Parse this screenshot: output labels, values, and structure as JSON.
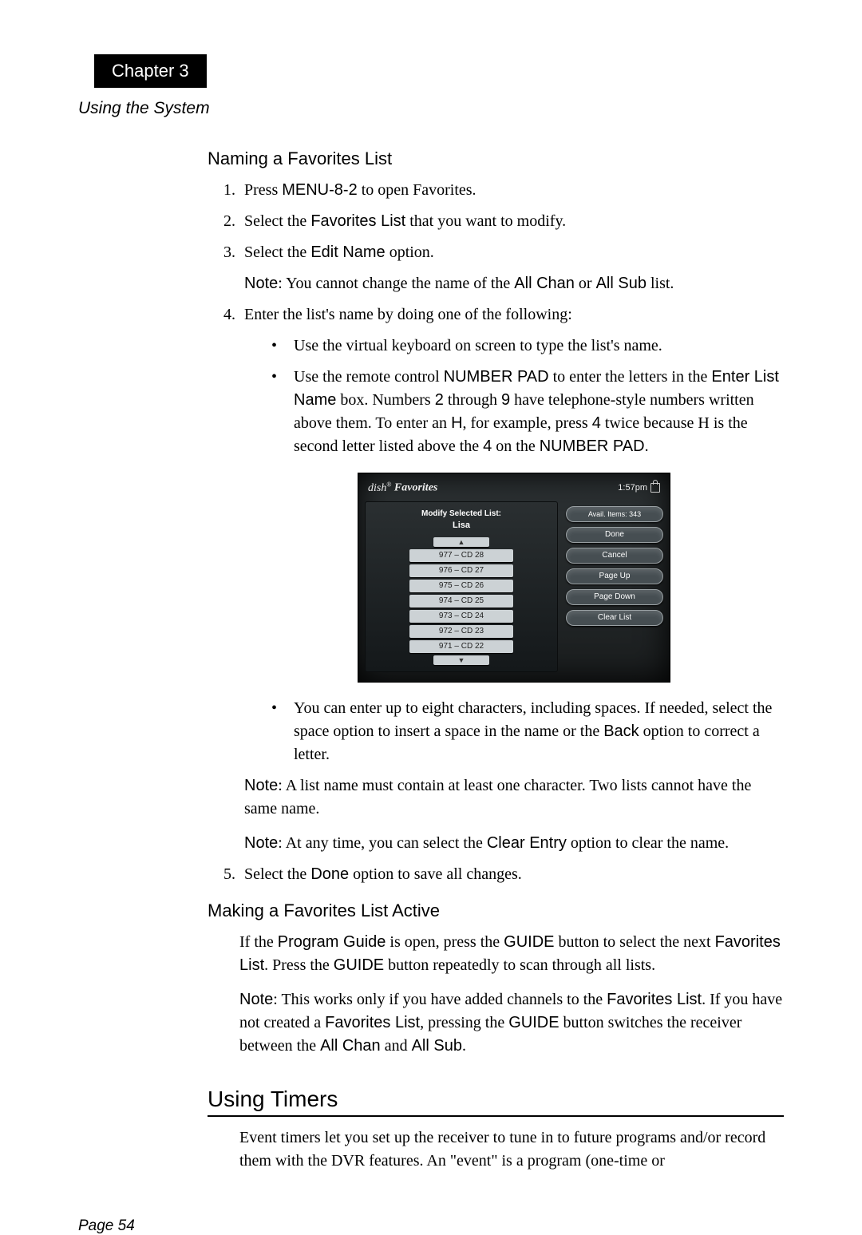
{
  "chapterTab": "Chapter 3",
  "sectionHeader": "Using the System",
  "naming": {
    "heading": "Naming a Favorites List",
    "step1a": "Press ",
    "step1_menu": "MENU-8-2",
    "step1b": " to open Favorites.",
    "step2a": "Select the ",
    "step2_fl": "Favorites List",
    "step2b": " that you want to modify.",
    "step3a": "Select the ",
    "step3_en": "Edit Name",
    "step3b": " option.",
    "step3_note_a": "Note",
    "step3_note_b": ": You cannot change the name of the ",
    "step3_note_ac": "All Chan",
    "step3_note_c": " or ",
    "step3_note_as": "All Sub",
    "step3_note_d": " list.",
    "step4": "Enter the list's name by doing one of the following:",
    "b1": "Use the virtual keyboard on screen to type the list's name.",
    "b2a": "Use the remote control ",
    "b2_np": "NUMBER PAD",
    "b2b": " to enter the letters in the ",
    "b2_eln": "Enter List Name",
    "b2c": " box. Numbers ",
    "b2_2": "2",
    "b2d": " through ",
    "b2_9": "9",
    "b2e": " have telephone-style numbers written above them. To enter an ",
    "b2_H": "H",
    "b2f": ", for example, press ",
    "b2_4": "4",
    "b2g": " twice because H is the second letter listed above the ",
    "b2_4b": "4",
    "b2h": " on the ",
    "b2_np2": "NUMBER PAD",
    "b2i": ".",
    "b3a": "You can enter up to eight characters, including spaces. If needed, select the space option to insert a space in the name or the ",
    "b3_back": "Back",
    "b3b": " option to correct a letter.",
    "note2a": "Note",
    "note2b": ": A list name must contain at least one character. Two lists cannot have the same name.",
    "note3a": "Note",
    "note3b": ": At any time, you can select the ",
    "note3_ce": "Clear Entry",
    "note3c": " option to clear the name.",
    "step5a": "Select the ",
    "step5_done": "Done",
    "step5b": " option to save all changes."
  },
  "active": {
    "heading": "Making a Favorites List Active",
    "p1a": "If the ",
    "p1_pg": "Program Guide",
    "p1b": " is open, press the ",
    "p1_g": "GUIDE",
    "p1c": " button to select the next ",
    "p1_fl": "Favorites List",
    "p1d": ". Press the ",
    "p1_g2": "GUIDE",
    "p1e": " button repeatedly to scan through all lists.",
    "p2_note": "Note",
    "p2a": ": This works only if you have added channels to the ",
    "p2_fl": "Favorites List",
    "p2b": ". If you have not created a ",
    "p2_fl2": "Favorites List",
    "p2c": ", pressing the ",
    "p2_g": "GUIDE",
    "p2d": " button switches the receiver between the ",
    "p2_ac": "All Chan",
    "p2e": " and ",
    "p2_as": "All Sub",
    "p2f": "."
  },
  "timers": {
    "heading": "Using Timers",
    "p1": "Event timers let you set up the receiver to tune in to future programs and/or record them with the DVR features. An \"event\" is a program (one-time or"
  },
  "pageNum": "Page 54",
  "tv": {
    "brand": "dish",
    "brandR": "®",
    "title": "Favorites",
    "time": "1:57pm",
    "modify": "Modify Selected List:",
    "listName": "Lisa",
    "upArrow": "▲",
    "downArrow": "▼",
    "rows": [
      "977 – CD 28",
      "976 – CD 27",
      "975 – CD 26",
      "974 – CD 25",
      "973 – CD 24",
      "972 – CD 23",
      "971 – CD 22"
    ],
    "avail": "Avail. Items: 343",
    "done": "Done",
    "cancel": "Cancel",
    "pageUp": "Page Up",
    "pageDown": "Page Down",
    "clearList": "Clear List"
  }
}
